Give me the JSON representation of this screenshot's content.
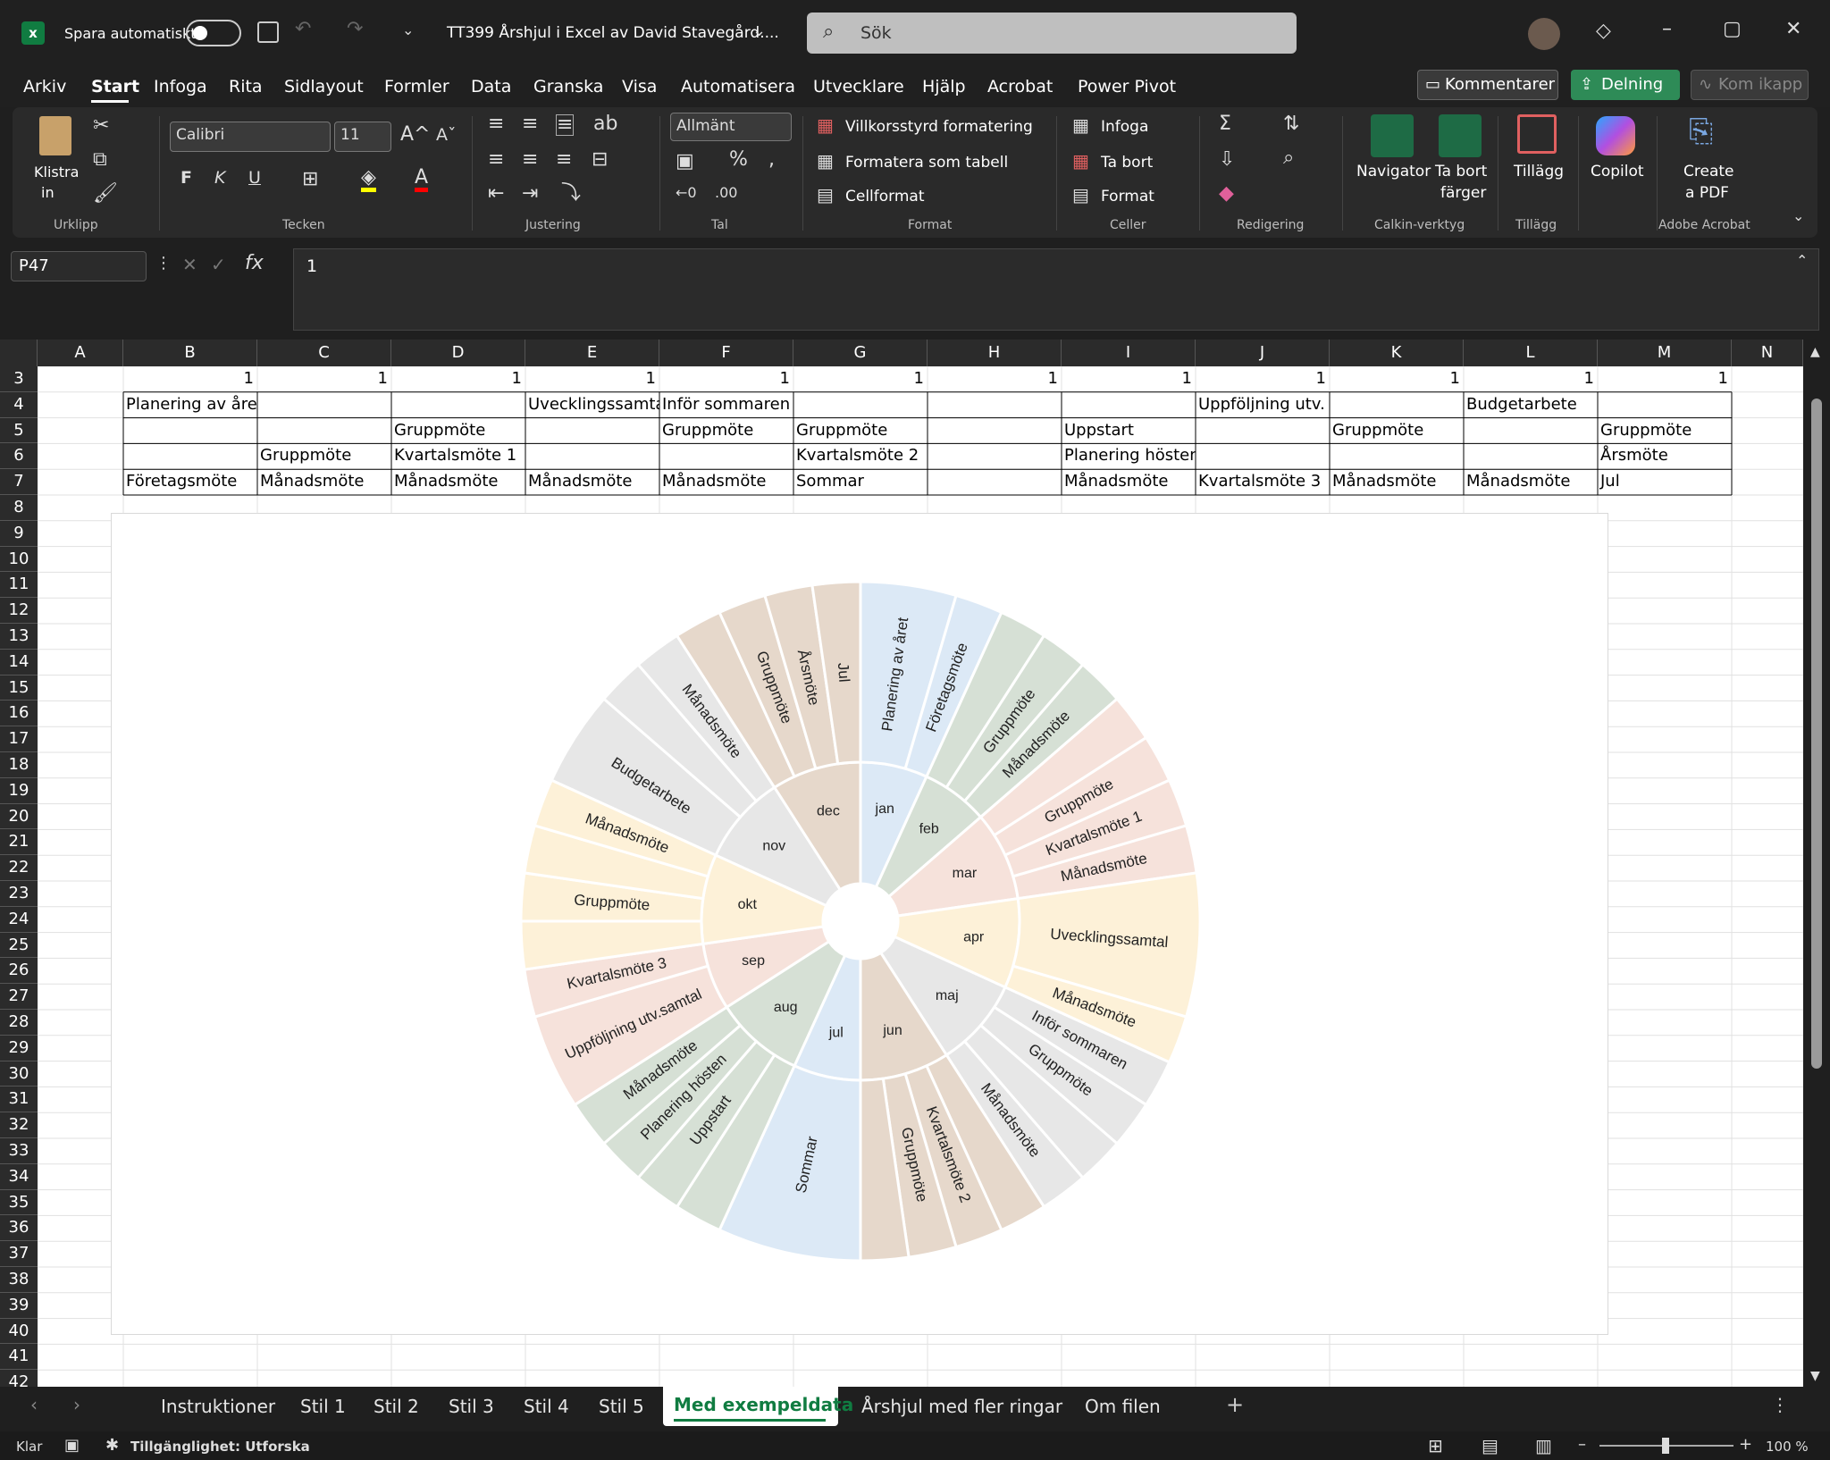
{
  "titlebar": {
    "autosave_label": "Spara automatiskt",
    "doc_title": "TT399 Årshjul i Excel av David Stavegård....",
    "search_placeholder": "Sök"
  },
  "menu": {
    "tabs": [
      "Arkiv",
      "Start",
      "Infoga",
      "Rita",
      "Sidlayout",
      "Formler",
      "Data",
      "Granska",
      "Visa",
      "Automatisera",
      "Utvecklare",
      "Hjälp",
      "Acrobat",
      "Power Pivot"
    ],
    "active": "Start",
    "comments_label": "Kommentarer",
    "share_label": "Delning",
    "catchup_label": "Kom ikapp"
  },
  "ribbon": {
    "paste_label1": "Klistra",
    "paste_label2": "in",
    "font_name": "Calibri",
    "font_size": "11",
    "number_format": "Allmänt",
    "cond_format": "Villkorsstyrd formatering",
    "format_table": "Formatera som tabell",
    "cell_styles": "Cellformat",
    "insert": "Infoga",
    "delete": "Ta bort",
    "format": "Format",
    "navigator": "Navigator",
    "remove_colors1": "Ta bort",
    "remove_colors2": "färger",
    "addins": "Tillägg",
    "copilot": "Copilot",
    "create_pdf1": "Create",
    "create_pdf2": "a PDF",
    "groups": {
      "clipboard": "Urklipp",
      "font": "Tecken",
      "alignment": "Justering",
      "number": "Tal",
      "styles": "Format",
      "cells": "Celler",
      "editing": "Redigering",
      "calkin": "Calkin-verktyg",
      "addins": "Tillägg",
      "acrobat": "Adobe Acrobat"
    }
  },
  "formula_bar": {
    "name_box": "P47",
    "value": "1"
  },
  "columns": [
    "A",
    "B",
    "C",
    "D",
    "E",
    "F",
    "G",
    "H",
    "I",
    "J",
    "K",
    "L",
    "M",
    "N"
  ],
  "rows": [
    "3",
    "4",
    "5",
    "6",
    "7",
    "8",
    "9",
    "10",
    "11",
    "12",
    "13",
    "14",
    "15",
    "16",
    "17",
    "18",
    "19",
    "20",
    "21",
    "22",
    "23",
    "24",
    "25",
    "26",
    "27",
    "28",
    "29",
    "30",
    "31",
    "32",
    "33",
    "34",
    "35",
    "36",
    "37",
    "38",
    "39",
    "40",
    "41",
    "42"
  ],
  "cells": {
    "row3": [
      "1",
      "1",
      "1",
      "1",
      "1",
      "1",
      "1",
      "1",
      "1",
      "1",
      "1",
      "1"
    ],
    "row4": [
      "Planering av året",
      "",
      "",
      "Uvecklingssamtal",
      "Inför sommaren",
      "",
      "",
      "",
      "Uppföljning utv.",
      "",
      "Budgetarbete",
      ""
    ],
    "row5": [
      "",
      "",
      "Gruppmöte",
      "",
      "Gruppmöte",
      "Gruppmöte",
      "",
      "Uppstart",
      "",
      "Gruppmöte",
      "",
      "Gruppmöte"
    ],
    "row6": [
      "",
      "Gruppmöte",
      "Kvartalsmöte 1",
      "",
      "",
      "Kvartalsmöte 2",
      "",
      "Planering hösten",
      "",
      "",
      "",
      "Årsmöte"
    ],
    "row7": [
      "Företagsmöte",
      "Månadsmöte",
      "Månadsmöte",
      "Månadsmöte",
      "Månadsmöte",
      "Sommar",
      "",
      "Månadsmöte",
      "Kvartalsmöte 3",
      "Månadsmöte",
      "Månadsmöte",
      "Jul"
    ]
  },
  "chart_data": {
    "type": "sunburst",
    "title": "",
    "months": [
      {
        "name": "jan",
        "color": "#dce9f6",
        "items": [
          {
            "label": "Planering av året",
            "v": 2
          },
          {
            "label": "Företagsmöte",
            "v": 1
          }
        ]
      },
      {
        "name": "feb",
        "color": "#d6e0d5",
        "items": [
          {
            "label": "",
            "v": 1
          },
          {
            "label": "Gruppmöte",
            "v": 1
          },
          {
            "label": "Månadsmöte",
            "v": 1
          }
        ]
      },
      {
        "name": "mar",
        "color": "#f6e2db",
        "items": [
          {
            "label": "",
            "v": 1
          },
          {
            "label": "Gruppmöte",
            "v": 1
          },
          {
            "label": "Kvartalsmöte 1",
            "v": 1
          },
          {
            "label": "Månadsmöte",
            "v": 1
          }
        ]
      },
      {
        "name": "apr",
        "color": "#fdf1d8",
        "items": [
          {
            "label": "Uvecklingssamtal",
            "v": 3
          },
          {
            "label": "Månadsmöte",
            "v": 1
          }
        ]
      },
      {
        "name": "maj",
        "color": "#e7e7e7",
        "items": [
          {
            "label": "Inför sommaren",
            "v": 1
          },
          {
            "label": "Gruppmöte",
            "v": 1
          },
          {
            "label": "",
            "v": 1
          },
          {
            "label": "Månadsmöte",
            "v": 1
          }
        ]
      },
      {
        "name": "jun",
        "color": "#e6d8cb",
        "items": [
          {
            "label": "",
            "v": 1
          },
          {
            "label": "Kvartalsmöte 2",
            "v": 1
          },
          {
            "label": "Gruppmöte",
            "v": 1
          },
          {
            "label": "",
            "v": 1
          }
        ]
      },
      {
        "name": "jul",
        "color": "#dce9f6",
        "items": [
          {
            "label": "Sommar",
            "v": 3
          }
        ]
      },
      {
        "name": "aug",
        "color": "#d6e0d5",
        "items": [
          {
            "label": "",
            "v": 1
          },
          {
            "label": "Uppstart",
            "v": 1
          },
          {
            "label": "Planering hösten",
            "v": 1
          },
          {
            "label": "Månadsmöte",
            "v": 1
          }
        ]
      },
      {
        "name": "sep",
        "color": "#f6e2db",
        "items": [
          {
            "label": "Uppföljning utv.samtal",
            "v": 2
          },
          {
            "label": "Kvartalsmöte 3",
            "v": 1
          }
        ]
      },
      {
        "name": "okt",
        "color": "#fdf1d8",
        "items": [
          {
            "label": "",
            "v": 1
          },
          {
            "label": "Gruppmöte",
            "v": 1
          },
          {
            "label": "",
            "v": 1
          },
          {
            "label": "Månadsmöte",
            "v": 1
          }
        ]
      },
      {
        "name": "nov",
        "color": "#e7e7e7",
        "items": [
          {
            "label": "Budgetarbete",
            "v": 2
          },
          {
            "label": "",
            "v": 1
          },
          {
            "label": "Månadsmöte",
            "v": 1
          }
        ]
      },
      {
        "name": "dec",
        "color": "#e6d8cb",
        "items": [
          {
            "label": "",
            "v": 1
          },
          {
            "label": "Gruppmöte",
            "v": 1
          },
          {
            "label": "Årsmöte",
            "v": 1
          },
          {
            "label": "Jul",
            "v": 1
          }
        ]
      }
    ]
  },
  "sheet_tabs": [
    "Instruktioner",
    "Stil 1",
    "Stil 2",
    "Stil 3",
    "Stil 4",
    "Stil 5",
    "Med exempeldata",
    "Årshjul med fler ringar",
    "Om filen"
  ],
  "active_sheet": "Med exempeldata",
  "status": {
    "ready": "Klar",
    "accessibility": "Tillgänglighet: Utforska",
    "zoom": "100 %"
  }
}
